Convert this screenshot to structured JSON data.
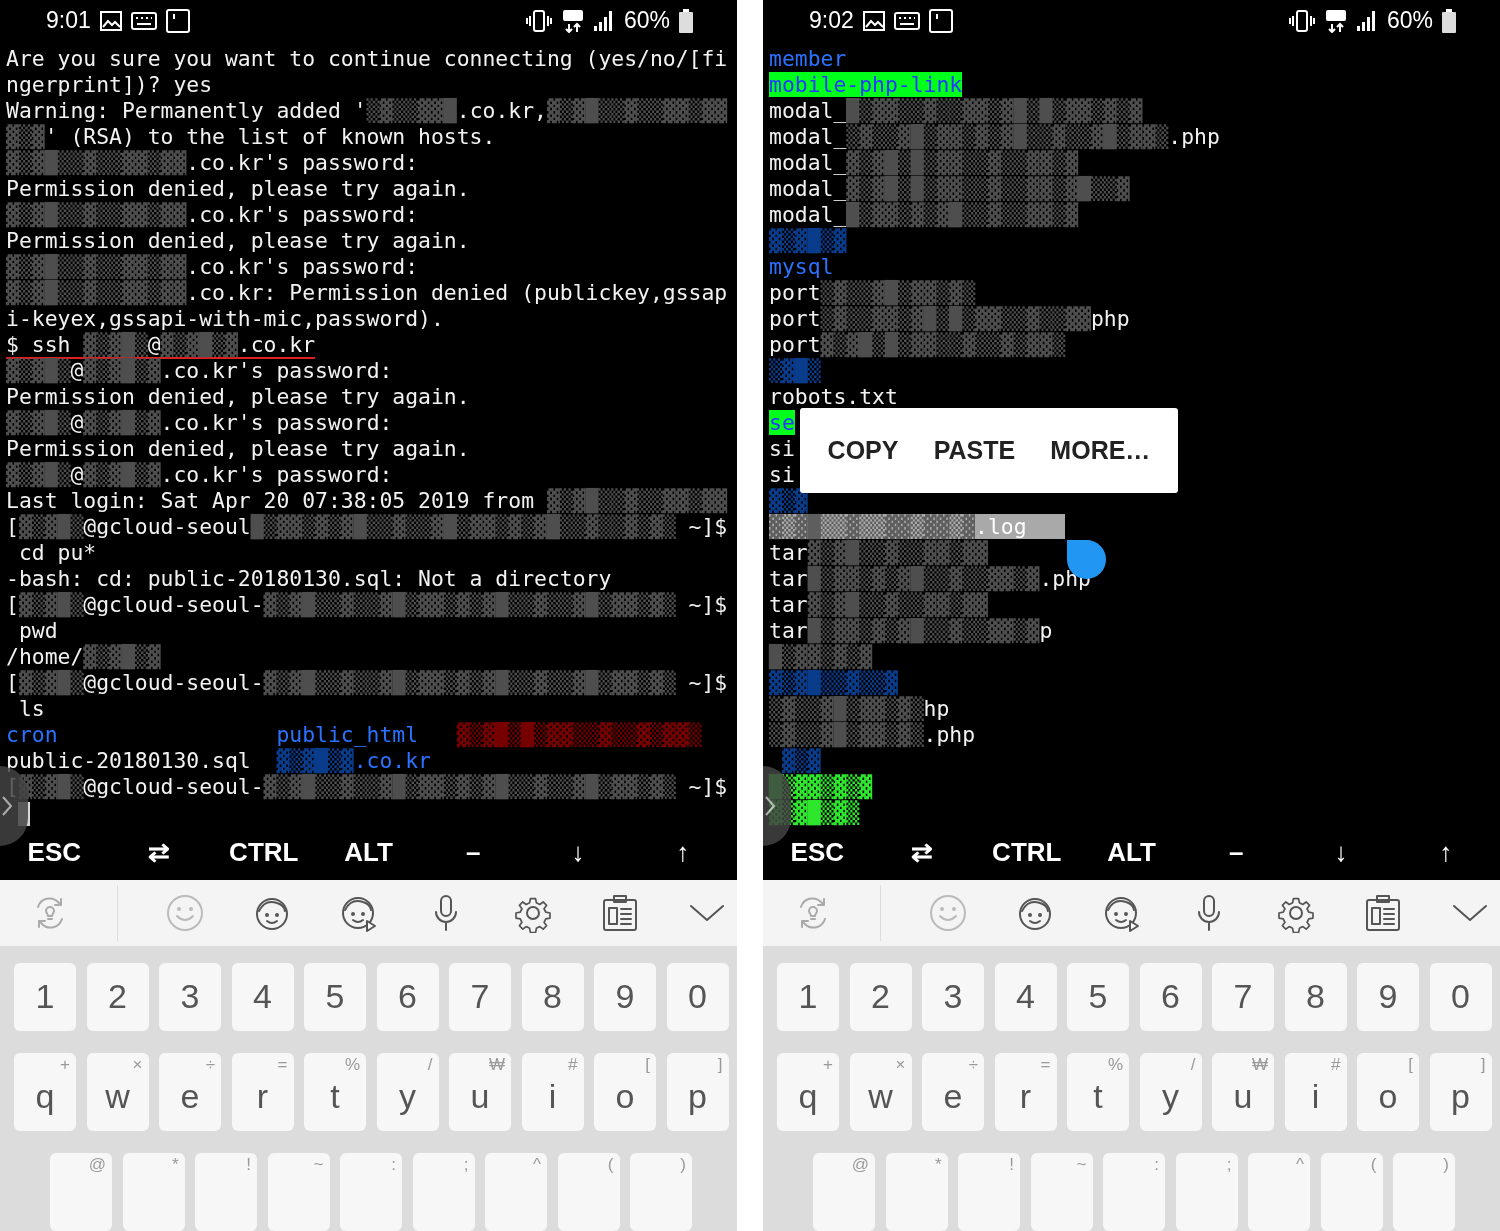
{
  "screens": [
    {
      "status_bar": {
        "time": "9:01",
        "battery": "60%"
      },
      "terminal": {
        "lines": [
          {
            "kind": "plain",
            "segments": [
              {
                "kind": "text",
                "text": "Are you sure you want to continue connecting (yes/no/[fi"
              }
            ]
          },
          {
            "kind": "plain",
            "segments": [
              {
                "kind": "text",
                "text": "ngerprint])? yes"
              }
            ]
          },
          {
            "kind": "plain",
            "segments": [
              {
                "kind": "text",
                "text": "Warning: Permanently added '"
              },
              {
                "kind": "mask",
                "text": "▒▓▒▒▓▓█"
              },
              {
                "kind": "text",
                "text": ".co.kr,"
              },
              {
                "kind": "mask",
                "text": "▓▒▓█▒▒▓▒▒▓▓▒▓▓"
              }
            ]
          },
          {
            "kind": "plain",
            "segments": [
              {
                "kind": "mask",
                "text": "▓▒▓"
              },
              {
                "kind": "text",
                "text": "' (RSA) to the list of known hosts."
              }
            ]
          },
          {
            "kind": "plain",
            "segments": [
              {
                "kind": "mask",
                "text": "▓▒▓█▒▒▓▒▒▓▓▒▓▓"
              },
              {
                "kind": "text",
                "text": ".co.kr's password:"
              }
            ]
          },
          {
            "kind": "plain",
            "segments": [
              {
                "kind": "text",
                "text": "Permission denied, please try again."
              }
            ]
          },
          {
            "kind": "plain",
            "segments": [
              {
                "kind": "mask",
                "text": "▓▒▓█▒▒▓▒▒▓▓▒▓▓"
              },
              {
                "kind": "text",
                "text": ".co.kr's password:"
              }
            ]
          },
          {
            "kind": "plain",
            "segments": [
              {
                "kind": "text",
                "text": "Permission denied, please try again."
              }
            ]
          },
          {
            "kind": "plain",
            "segments": [
              {
                "kind": "mask",
                "text": "▓▒▓█▒▒▓▒▒▓▓▒▓▓"
              },
              {
                "kind": "text",
                "text": ".co.kr's password:"
              }
            ]
          },
          {
            "kind": "plain",
            "segments": [
              {
                "kind": "mask",
                "text": "▓▒▓█▒▒▓▒▒▓▓▒▓▓"
              },
              {
                "kind": "text",
                "text": ".co.kr: Permission denied (publickey,gssap"
              }
            ]
          },
          {
            "kind": "plain",
            "segments": [
              {
                "kind": "text",
                "text": "i-keyex,gssapi-with-mic,password)."
              }
            ]
          },
          {
            "kind": "plain",
            "underlined": true,
            "segments": [
              {
                "kind": "text",
                "text": "$ ssh"
              },
              {
                "kind": "mask",
                "text": " ▓▒▓█▒"
              },
              {
                "kind": "text",
                "text": "@"
              },
              {
                "kind": "mask",
                "text": "▓▒▓█▒▓"
              },
              {
                "kind": "text",
                "text": ".co.kr"
              }
            ]
          },
          {
            "kind": "plain",
            "segments": [
              {
                "kind": "mask",
                "text": "▓▒▓█▒"
              },
              {
                "kind": "text",
                "text": "@"
              },
              {
                "kind": "mask",
                "text": "▓▒▓█▒▓"
              },
              {
                "kind": "text",
                "text": ".co.kr's password:"
              }
            ]
          },
          {
            "kind": "plain",
            "segments": [
              {
                "kind": "text",
                "text": "Permission denied, please try again."
              }
            ]
          },
          {
            "kind": "plain",
            "segments": [
              {
                "kind": "mask",
                "text": "▓▒▓█▒"
              },
              {
                "kind": "text",
                "text": "@"
              },
              {
                "kind": "mask",
                "text": "▓▒▓█▒▓"
              },
              {
                "kind": "text",
                "text": ".co.kr's password:"
              }
            ]
          },
          {
            "kind": "plain",
            "segments": [
              {
                "kind": "text",
                "text": "Permission denied, please try again."
              }
            ]
          },
          {
            "kind": "plain",
            "segments": [
              {
                "kind": "mask",
                "text": "▓▒▓█▒"
              },
              {
                "kind": "text",
                "text": "@"
              },
              {
                "kind": "mask",
                "text": "▓▒▓█▒▓"
              },
              {
                "kind": "text",
                "text": ".co.kr's password:"
              }
            ]
          },
          {
            "kind": "plain",
            "segments": [
              {
                "kind": "text",
                "text": "Last login: Sat Apr 20 07:38:05 2019 from"
              },
              {
                "kind": "mask",
                "text": " ▓▒▓█▒▒▓▒▒▓▓▒▓▓"
              }
            ]
          },
          {
            "kind": "plain",
            "segments": [
              {
                "kind": "text",
                "text": "["
              },
              {
                "kind": "mask",
                "text": "▓▒▓█▒"
              },
              {
                "kind": "text",
                "text": "@gcloud-seoul"
              },
              {
                "kind": "mask",
                "text": "█▒▓▓▒▓▒▓█▒▒▓▒▒▓█▒▓▓▒▓▒▓█▒▒▓▒▒▓▒▓▒ "
              },
              {
                "kind": "text",
                "text": "~]$"
              }
            ]
          },
          {
            "kind": "plain",
            "segments": [
              {
                "kind": "text",
                "text": " cd pu*"
              }
            ]
          },
          {
            "kind": "plain",
            "segments": [
              {
                "kind": "text",
                "text": "-bash: cd: public-20180130.sql: Not a directory"
              }
            ]
          },
          {
            "kind": "plain",
            "segments": [
              {
                "kind": "text",
                "text": "["
              },
              {
                "kind": "mask",
                "text": "▓▒▓█▒"
              },
              {
                "kind": "text",
                "text": "@gcloud-seoul-"
              },
              {
                "kind": "mask",
                "text": "▓▒▓█▒▒▓▒▒▓█▒▓▓▒▓▒▓█▒▒▓▒▒▓█▒▓▓▒▓▒ "
              },
              {
                "kind": "text",
                "text": "~]$"
              }
            ]
          },
          {
            "kind": "plain",
            "segments": [
              {
                "kind": "text",
                "text": " pwd"
              }
            ]
          },
          {
            "kind": "plain",
            "segments": [
              {
                "kind": "text",
                "text": "/home/"
              },
              {
                "kind": "mask",
                "text": "▓▒▓█▒▓"
              }
            ]
          },
          {
            "kind": "plain",
            "segments": [
              {
                "kind": "text",
                "text": "["
              },
              {
                "kind": "mask",
                "text": "▓▒▓█▒"
              },
              {
                "kind": "text",
                "text": "@gcloud-seoul-"
              },
              {
                "kind": "mask",
                "text": "▓▒▓█▒▒▓▒▒▓█▒▓▓▒▓▒▓█▒▒▓▒▒▓█▒▓▓▒▓▒ "
              },
              {
                "kind": "text",
                "text": "~]$"
              }
            ]
          },
          {
            "kind": "plain",
            "segments": [
              {
                "kind": "text",
                "text": " ls"
              }
            ]
          },
          {
            "kind": "columns",
            "cells": [
              [
                {
                  "kind": "dir",
                  "text": "cron"
                }
              ],
              [
                {
                  "kind": "dir",
                  "text": "public_html"
                }
              ],
              [
                {
                  "kind": "mask-red",
                  "text": "▓▒▓█▒█▒▓▓▒▒▓▒▒▓▒▓▓▒"
                }
              ]
            ]
          },
          {
            "kind": "columns",
            "cells": [
              [
                {
                  "kind": "text",
                  "text": "public-20180130.sql"
                }
              ],
              [
                {
                  "kind": "mask-blue",
                  "text": "▓▒▓█▒▓"
                },
                {
                  "kind": "dir",
                  "text": ".co.kr"
                }
              ]
            ]
          },
          {
            "kind": "plain",
            "segments": [
              {
                "kind": "text",
                "text": "["
              },
              {
                "kind": "mask",
                "text": "▓▒▓█▒"
              },
              {
                "kind": "text",
                "text": "@gcloud-seoul-"
              },
              {
                "kind": "mask",
                "text": "▓▒▓█▒▒▓▒▒▓█▒▓▓▒▓▒▓█▒▒▓▒▒▓█▒▓▓▒▓▒ "
              },
              {
                "kind": "text",
                "text": "~]$"
              }
            ]
          },
          {
            "kind": "cursor"
          }
        ]
      },
      "extra_keys": [
        {
          "label": "ESC"
        },
        {
          "label": "⇄"
        },
        {
          "label": "CTRL"
        },
        {
          "label": "ALT"
        },
        {
          "label": "–"
        },
        {
          "label": "↓"
        },
        {
          "label": "↑"
        }
      ],
      "keyboard": {
        "rows": [
          [
            {
              "label": "1"
            },
            {
              "label": "2"
            },
            {
              "label": "3"
            },
            {
              "label": "4"
            },
            {
              "label": "5"
            },
            {
              "label": "6"
            },
            {
              "label": "7"
            },
            {
              "label": "8"
            },
            {
              "label": "9"
            },
            {
              "label": "0"
            }
          ],
          [
            {
              "label": "q",
              "hint": "+"
            },
            {
              "label": "w",
              "hint": "×"
            },
            {
              "label": "e",
              "hint": "÷"
            },
            {
              "label": "r",
              "hint": "="
            },
            {
              "label": "t",
              "hint": "%"
            },
            {
              "label": "y",
              "hint": "/"
            },
            {
              "label": "u",
              "hint": "₩"
            },
            {
              "label": "i",
              "hint": "#"
            },
            {
              "label": "o",
              "hint": "["
            },
            {
              "label": "p",
              "hint": "]"
            }
          ],
          [
            {
              "hint": "@"
            },
            {
              "hint": "*"
            },
            {
              "hint": "!"
            },
            {
              "hint": "~"
            },
            {
              "hint": ":"
            },
            {
              "hint": ";"
            },
            {
              "hint": "^"
            },
            {
              "hint": "("
            },
            {
              "hint": ")"
            }
          ]
        ]
      }
    },
    {
      "status_bar": {
        "time": "9:02",
        "battery": "60%"
      },
      "terminal": {
        "lines": [
          {
            "kind": "plain",
            "segments": [
              {
                "kind": "dir",
                "text": "member"
              }
            ]
          },
          {
            "kind": "plain",
            "segments": [
              {
                "kind": "dir-hl",
                "text": "mobile-php-link"
              }
            ]
          },
          {
            "kind": "plain",
            "segments": [
              {
                "kind": "text",
                "text": "modal_"
              },
              {
                "kind": "mask",
                "text": "█▒▓▓▒▒▓▒▒▓▓▒▓█▒█▒▓▓▒▓▒▓"
              }
            ]
          },
          {
            "kind": "plain",
            "segments": [
              {
                "kind": "text",
                "text": "modal_"
              },
              {
                "kind": "mask",
                "text": "▒▓▒▒▓█▒▓▓▒▓▒▓█▒▒▓▒▒▓█▒▓▓▒"
              },
              {
                "kind": "text",
                "text": ".php"
              }
            ]
          },
          {
            "kind": "plain",
            "segments": [
              {
                "kind": "text",
                "text": "modal_"
              },
              {
                "kind": "mask",
                "text": "▓▒▓█▒█▒▓▓▒▒▓▒▒▓▓▒▓"
              }
            ]
          },
          {
            "kind": "plain",
            "segments": [
              {
                "kind": "text",
                "text": "modal_"
              },
              {
                "kind": "mask",
                "text": "▓▒▓█▒█▒▓▓▒▒▓▒▒▓▓▒▓█▒▒▓"
              }
            ]
          },
          {
            "kind": "plain",
            "segments": [
              {
                "kind": "text",
                "text": "modal_"
              },
              {
                "kind": "mask",
                "text": "█▒▓▓▒▓▒▓█▒▒▓▒▒▓▓▒▓"
              }
            ]
          },
          {
            "kind": "plain",
            "segments": [
              {
                "kind": "mask-blue",
                "text": "▓▒▓█▒▓"
              }
            ]
          },
          {
            "kind": "plain",
            "segments": [
              {
                "kind": "dir",
                "text": "mysql"
              }
            ]
          },
          {
            "kind": "plain",
            "segments": [
              {
                "kind": "text",
                "text": "port"
              },
              {
                "kind": "mask",
                "text": "▒▓▒▒▓█▒▓▓▒▓▒"
              }
            ]
          },
          {
            "kind": "plain",
            "segments": [
              {
                "kind": "text",
                "text": "port"
              },
              {
                "kind": "mask",
                "text": "▒▓▒▒▓▓▒▓█▒█▒▓▓▒▒▓▒▒▓▓"
              },
              {
                "kind": "text",
                "text": "php"
              }
            ]
          },
          {
            "kind": "plain",
            "segments": [
              {
                "kind": "text",
                "text": "port"
              },
              {
                "kind": "mask",
                "text": "▓▒▓█▒█▒▓▓▒▒▓▒▒▓▒▓▓▒"
              }
            ]
          },
          {
            "kind": "plain",
            "segments": [
              {
                "kind": "mask-blue",
                "text": "▒▓█▒"
              }
            ]
          },
          {
            "kind": "plain",
            "segments": [
              {
                "kind": "text",
                "text": "robots.txt"
              }
            ]
          },
          {
            "kind": "plain",
            "segments": [
              {
                "kind": "dir-hl",
                "text": "se"
              }
            ]
          },
          {
            "kind": "plain",
            "segments": [
              {
                "kind": "text",
                "text": "si"
              }
            ]
          },
          {
            "kind": "plain",
            "segments": [
              {
                "kind": "text",
                "text": "si"
              }
            ]
          },
          {
            "kind": "plain",
            "segments": [
              {
                "kind": "mask-blue",
                "text": "▓▒▓"
              }
            ]
          },
          {
            "kind": "plain",
            "segments": [
              {
                "kind": "sel-mask",
                "text": "▓▒▓█▒▒▓▒▒▓▓▒▓▓▒▓"
              },
              {
                "kind": "sel",
                "text": ".log"
              }
            ]
          },
          {
            "kind": "plain",
            "segments": [
              {
                "kind": "text",
                "text": "tar"
              },
              {
                "kind": "mask",
                "text": "▓▒▓█▒▒▓▒▒▓▓▒▓▓"
              }
            ]
          },
          {
            "kind": "plain",
            "segments": [
              {
                "kind": "text",
                "text": "tar"
              },
              {
                "kind": "mask",
                "text": "█▒▓▓▒▓▒▓█▒▒▓▒▒▓▓▒▓"
              },
              {
                "kind": "text",
                "text": ".php"
              }
            ]
          },
          {
            "kind": "plain",
            "segments": [
              {
                "kind": "text",
                "text": "tar"
              },
              {
                "kind": "mask",
                "text": "▓▒▓█▒▒▓▒▒▓▓▒▓▓"
              }
            ]
          },
          {
            "kind": "plain",
            "segments": [
              {
                "kind": "text",
                "text": "tar"
              },
              {
                "kind": "mask",
                "text": "█▒▓▓▒▓▒▓█▒▒▓▒▒▓▓▒▓"
              },
              {
                "kind": "text",
                "text": "p"
              }
            ]
          },
          {
            "kind": "plain",
            "segments": [
              {
                "kind": "mask",
                "text": "█▒▓▓▒▓▒▓"
              }
            ]
          },
          {
            "kind": "plain",
            "segments": [
              {
                "kind": "mask-blue",
                "text": "▓▒▓█▒▒▓▒▒▓"
              }
            ]
          },
          {
            "kind": "plain",
            "segments": [
              {
                "kind": "mask",
                "text": "▒▓▒▒▓█▒▓▓▒▓▒"
              },
              {
                "kind": "text",
                "text": "hp"
              }
            ]
          },
          {
            "kind": "plain",
            "segments": [
              {
                "kind": "mask",
                "text": "▒▓▒▒▓█▒▓▓▒▓▒"
              },
              {
                "kind": "text",
                "text": ".php"
              }
            ]
          },
          {
            "kind": "plain",
            "segments": [
              {
                "kind": "mask-blue",
                "text": " ▓▒▓"
              }
            ]
          },
          {
            "kind": "plain",
            "segments": [
              {
                "kind": "mask-green",
                "text": "█▒▓▓▒▓▒▓"
              }
            ]
          },
          {
            "kind": "plain",
            "segments": [
              {
                "kind": "mask-green",
                "text": "▓▒▓█▒▓▒"
              }
            ]
          }
        ]
      },
      "popup": {
        "items": [
          "COPY",
          "PASTE",
          "MORE…"
        ]
      },
      "selection_handle": true,
      "extra_keys": [
        {
          "label": "ESC"
        },
        {
          "label": "⇄"
        },
        {
          "label": "CTRL"
        },
        {
          "label": "ALT"
        },
        {
          "label": "–"
        },
        {
          "label": "↓"
        },
        {
          "label": "↑"
        }
      ],
      "keyboard": {
        "rows": [
          [
            {
              "label": "1"
            },
            {
              "label": "2"
            },
            {
              "label": "3"
            },
            {
              "label": "4"
            },
            {
              "label": "5"
            },
            {
              "label": "6"
            },
            {
              "label": "7"
            },
            {
              "label": "8"
            },
            {
              "label": "9"
            },
            {
              "label": "0"
            }
          ],
          [
            {
              "label": "q",
              "hint": "+"
            },
            {
              "label": "w",
              "hint": "×"
            },
            {
              "label": "e",
              "hint": "÷"
            },
            {
              "label": "r",
              "hint": "="
            },
            {
              "label": "t",
              "hint": "%"
            },
            {
              "label": "y",
              "hint": "/"
            },
            {
              "label": "u",
              "hint": "₩"
            },
            {
              "label": "i",
              "hint": "#"
            },
            {
              "label": "o",
              "hint": "["
            },
            {
              "label": "p",
              "hint": "]"
            }
          ],
          [
            {
              "hint": "@"
            },
            {
              "hint": "*"
            },
            {
              "hint": "!"
            },
            {
              "hint": "~"
            },
            {
              "hint": ":"
            },
            {
              "hint": ";"
            },
            {
              "hint": "^"
            },
            {
              "hint": "("
            },
            {
              "hint": ")"
            }
          ]
        ]
      }
    }
  ]
}
